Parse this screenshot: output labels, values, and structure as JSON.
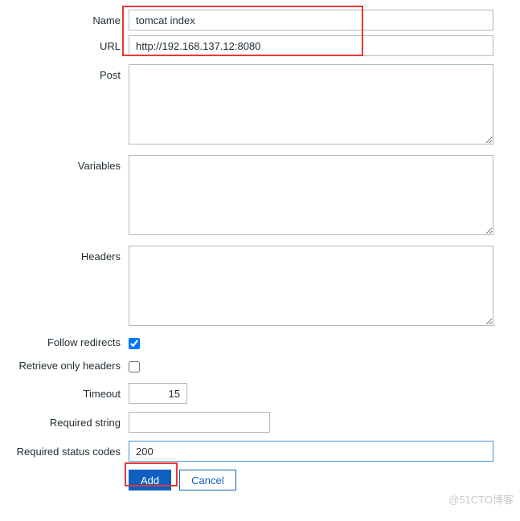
{
  "labels": {
    "name": "Name",
    "url": "URL",
    "post": "Post",
    "variables": "Variables",
    "headers": "Headers",
    "follow_redirects": "Follow redirects",
    "retrieve_only_headers": "Retrieve only headers",
    "timeout": "Timeout",
    "required_string": "Required string",
    "required_status_codes": "Required status codes"
  },
  "values": {
    "name": "tomcat index",
    "url": "http://192.168.137.12:8080",
    "post": "",
    "variables": "",
    "headers": "",
    "follow_redirects": true,
    "retrieve_only_headers": false,
    "timeout": "15",
    "required_string": "",
    "required_status_codes": "200"
  },
  "buttons": {
    "add": "Add",
    "cancel": "Cancel"
  },
  "watermark": "@51CTO博客"
}
